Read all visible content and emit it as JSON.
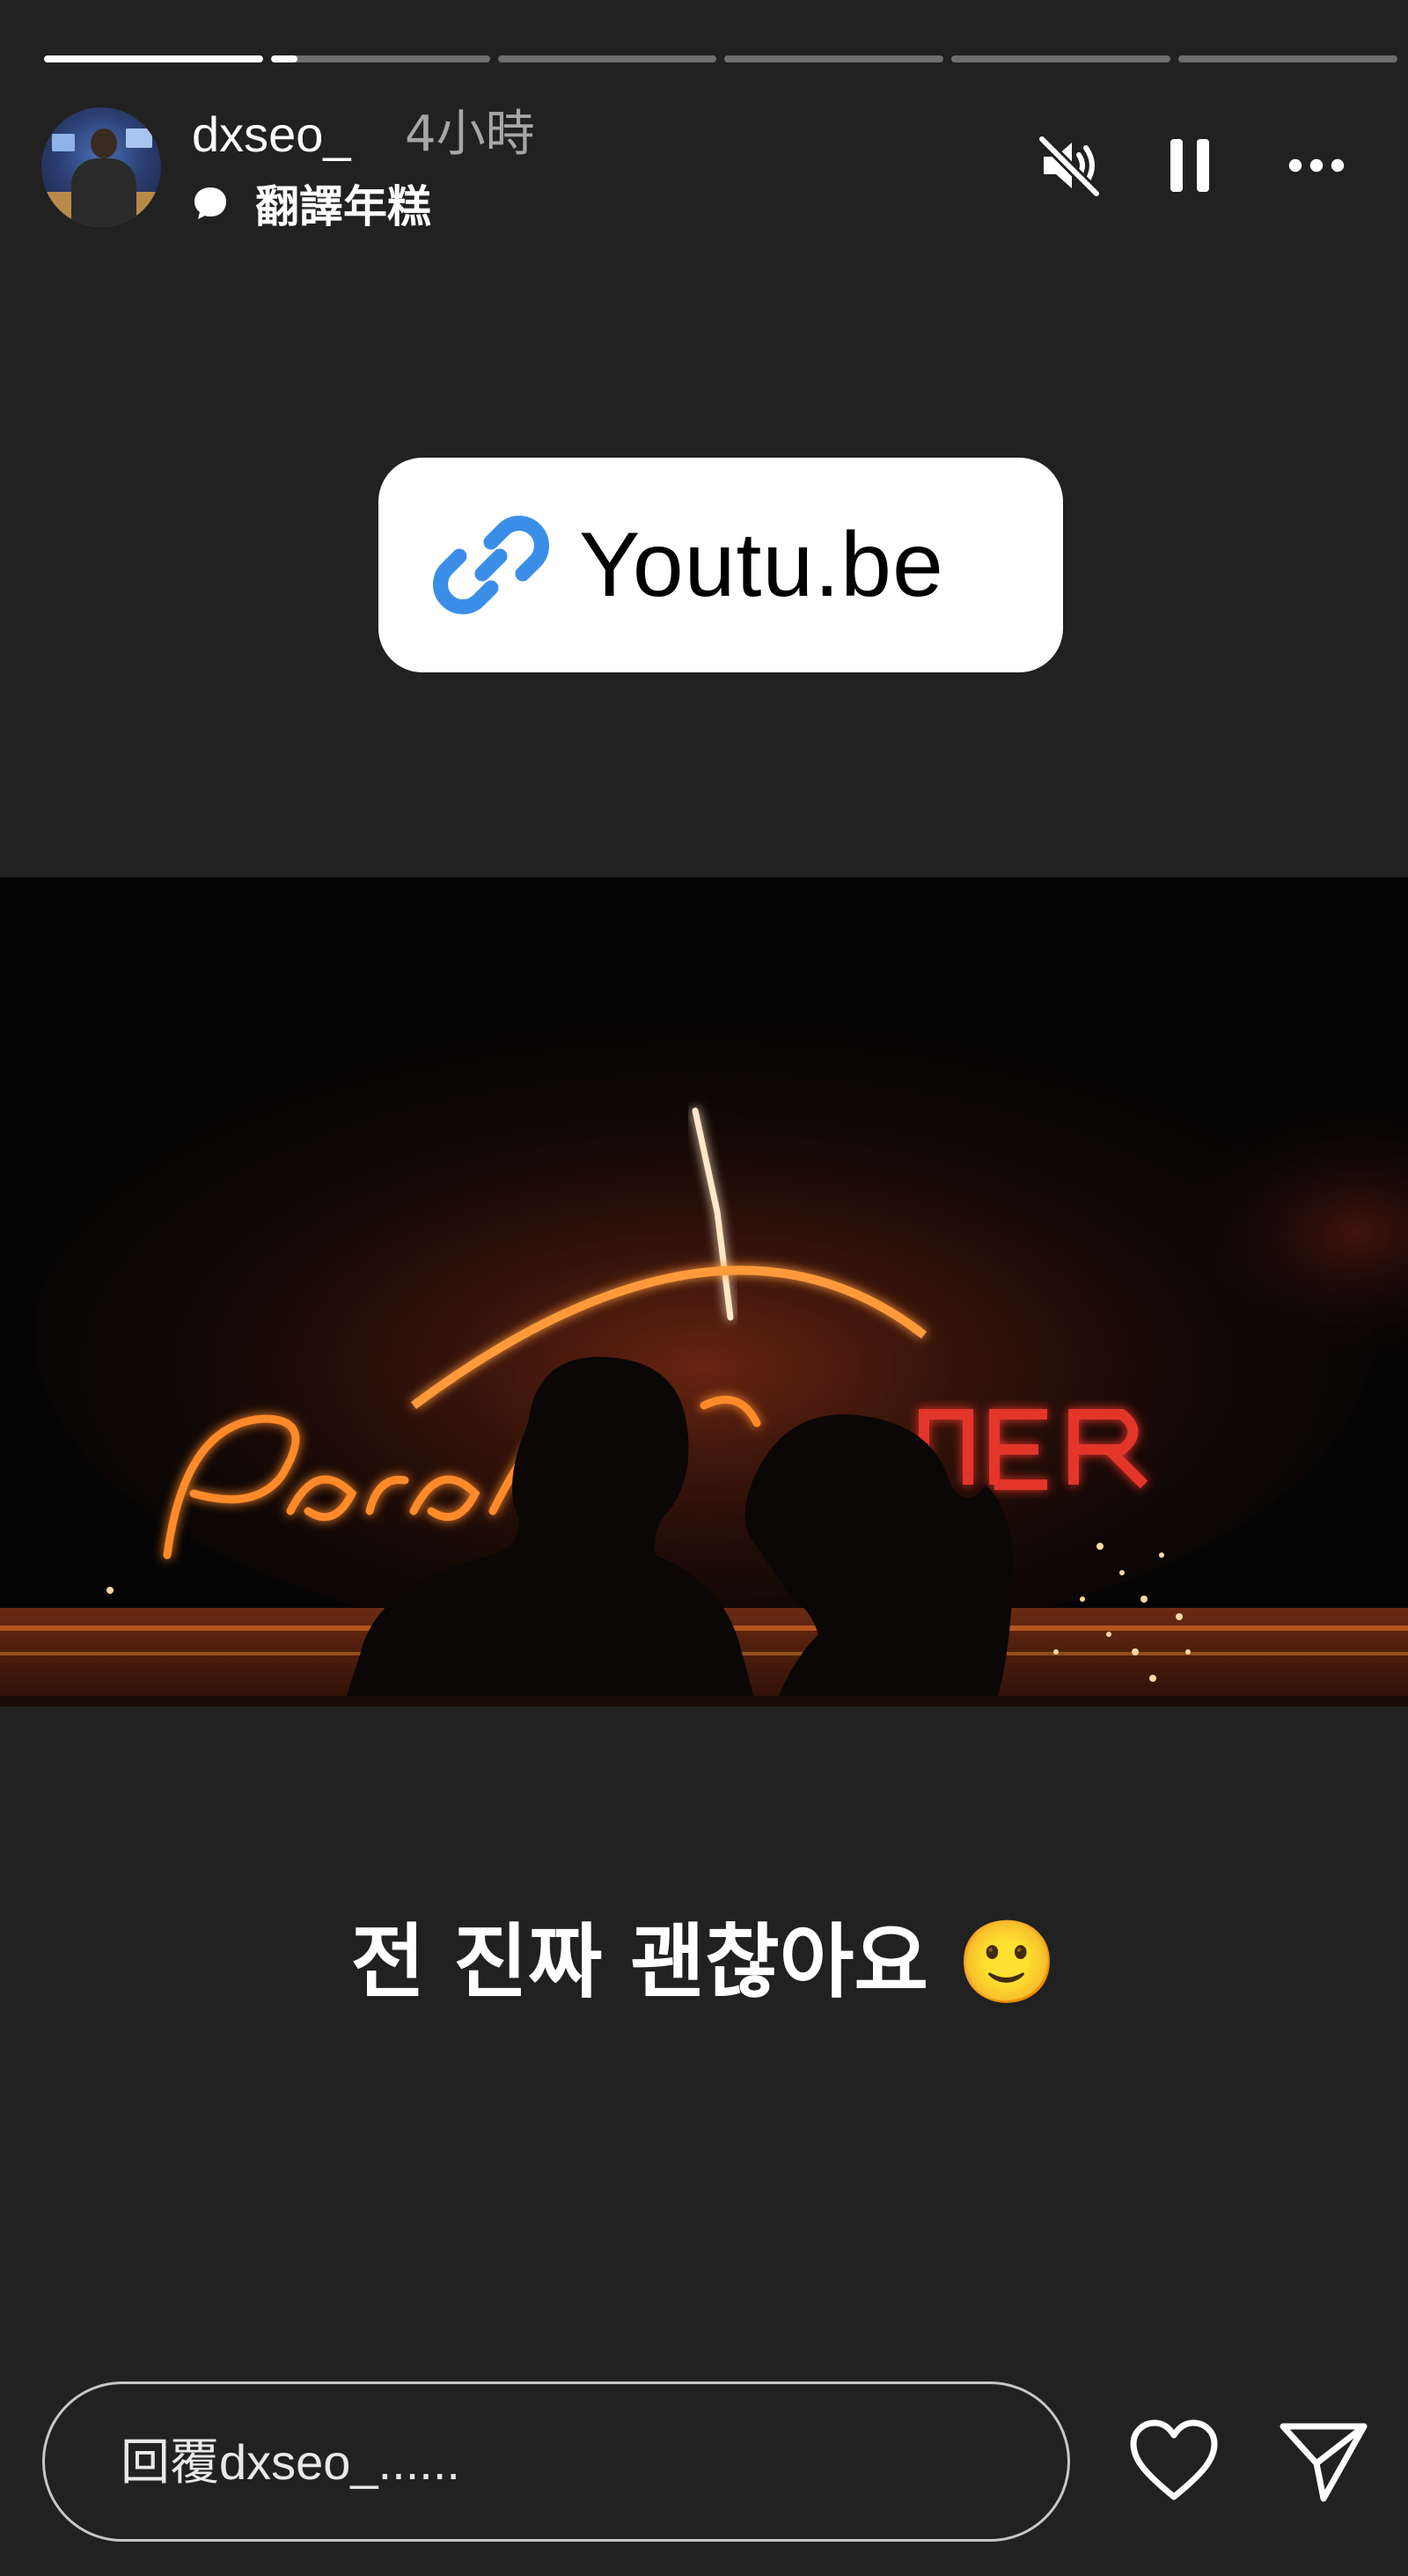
{
  "progress": {
    "segments": [
      1.0,
      0.12,
      0,
      0,
      0,
      0
    ]
  },
  "header": {
    "username": "dxseo_",
    "timestamp": "4小時",
    "audio_title": "翻譯年糕",
    "icons": {
      "mute": "speaker-muted-icon",
      "pause": "pause-icon",
      "more": "more-options-icon"
    }
  },
  "link_sticker": {
    "icon": "link-icon",
    "label": "Youtu.be"
  },
  "thumbnail": {
    "description_icon": "video-thumbnail"
  },
  "caption": {
    "text": "전 진짜 괜찮아요 🙂"
  },
  "reply": {
    "placeholder": "回覆dxseo_......",
    "like_icon": "heart-icon",
    "send_icon": "send-icon"
  },
  "colors": {
    "background": "#212121",
    "link_icon_blue": "#3b8ee8",
    "neon_orange": "#ff8a2a",
    "neon_red": "#e4342a"
  }
}
